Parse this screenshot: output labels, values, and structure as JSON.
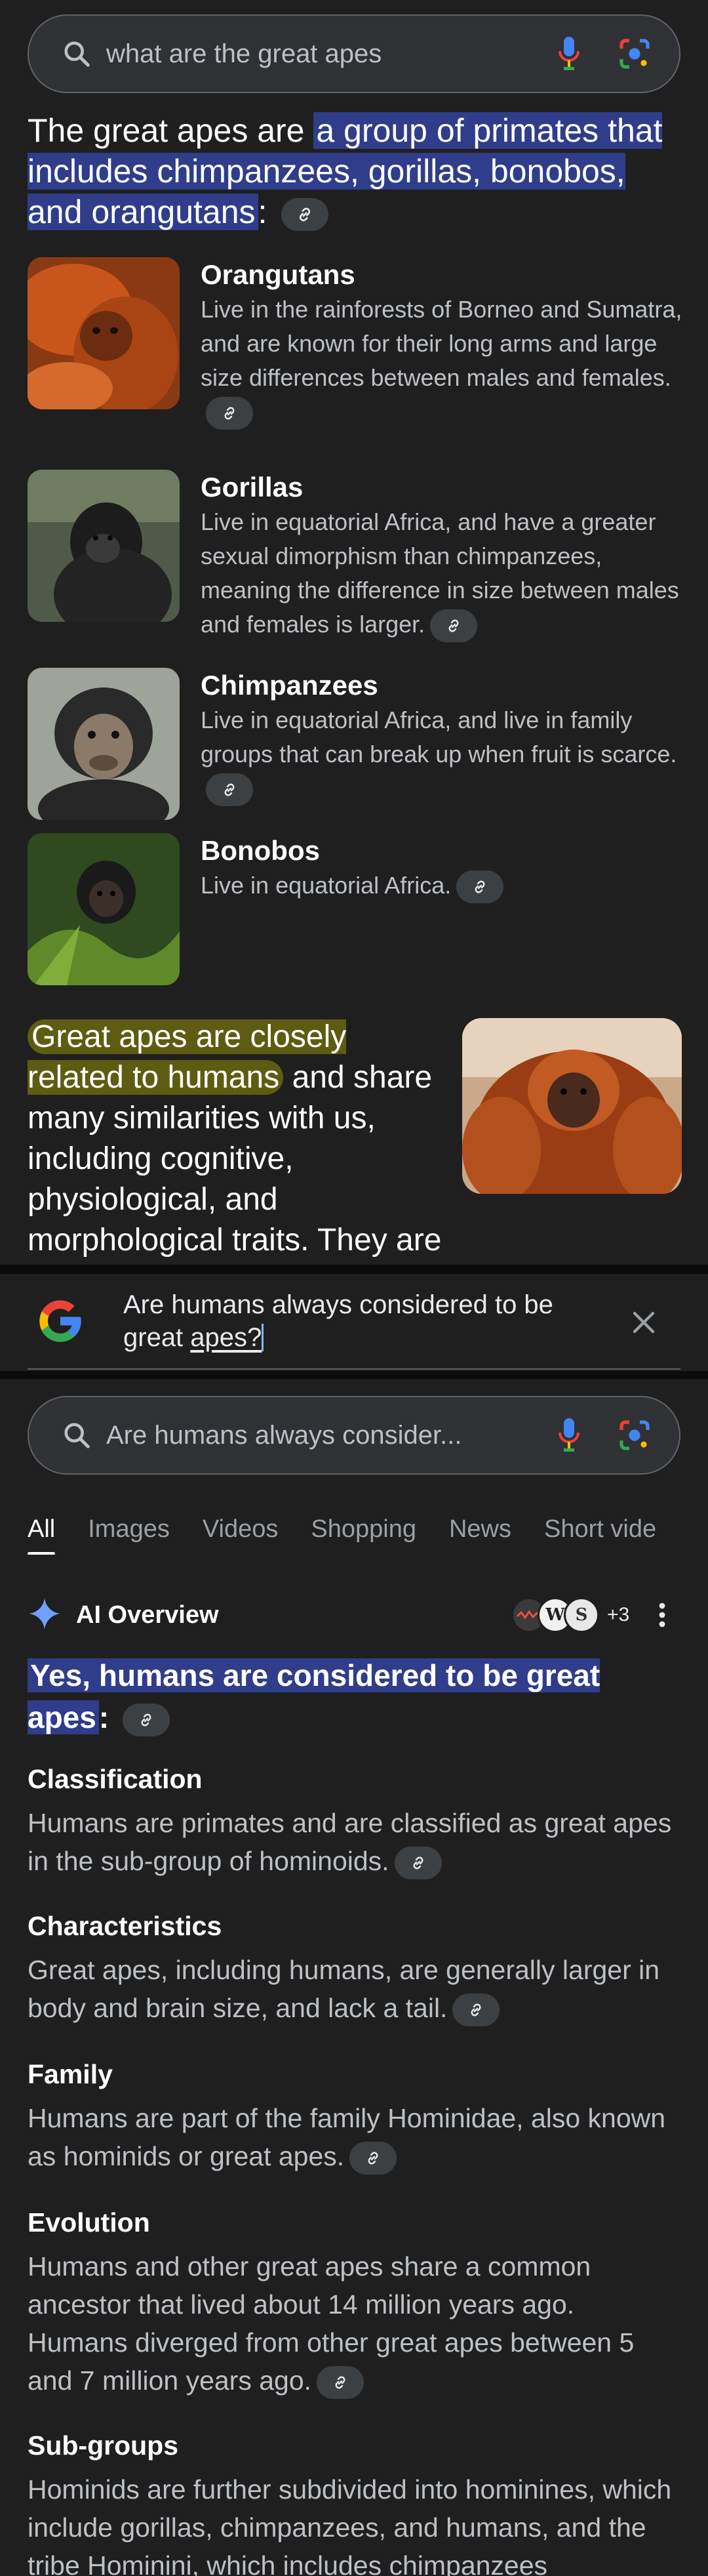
{
  "top_search": {
    "query": "what are the great apes"
  },
  "intro": {
    "prefix": "The great apes are ",
    "highlight": "a group of primates that includes chimpanzees, gorillas, bonobos, and orangutans",
    "suffix": ":"
  },
  "apes": [
    {
      "name": "Orangutans",
      "desc": "Live in the rainforests of Borneo and Sumatra, and are known for their long arms and large size differences between males and females."
    },
    {
      "name": "Gorillas",
      "desc": "Live in equatorial Africa, and have a greater sexual dimorphism than chimpanzees, meaning the difference in size between males and females is larger."
    },
    {
      "name": "Chimpanzees",
      "desc": "Live in equatorial Africa, and live in family groups that can break up when fruit is scarce."
    },
    {
      "name": "Bonobos",
      "desc": "Live in equatorial Africa."
    }
  ],
  "related": {
    "highlight": "Great apes are closely related to humans",
    "rest": " and share many similarities with us, including cognitive, physiological, and morphological traits. They are active during the day and communicate"
  },
  "followup": {
    "text_before": "Are humans always considered to be great ",
    "underlined": "apes?"
  },
  "second_search": {
    "query": "Are humans always consider..."
  },
  "tabs": [
    "All",
    "Images",
    "Videos",
    "Shopping",
    "News",
    "Short vide"
  ],
  "ai_overview": {
    "title": "AI Overview",
    "source_count": "+3",
    "answer": "Yes, humans are considered to be great apes",
    "answer_suffix": ":",
    "sections": [
      {
        "heading": "Classification",
        "text": "Humans are primates and are classified as great apes in the sub-group of hominoids."
      },
      {
        "heading": "Characteristics",
        "text": "Great apes, including humans, are generally larger in body and brain size, and lack a tail."
      },
      {
        "heading": "Family",
        "text": "Humans are part of the family Hominidae, also known as hominids or great apes."
      },
      {
        "heading": "Evolution",
        "text": "Humans and other great apes share a common ancestor that lived about 14 million years ago. Humans diverged from other great apes between 5 and 7 million years ago."
      },
      {
        "heading": "Sub-groups",
        "text": "Hominids are further subdivided into hominines, which include gorillas, chimpanzees, and humans, and the tribe Hominini, which includes chimpanzees"
      }
    ]
  },
  "colors": {
    "background": "#1f1f1f",
    "highlight_blue": "#2f3d8a",
    "highlight_yellow": "#5d5c12",
    "surface": "#303134"
  }
}
